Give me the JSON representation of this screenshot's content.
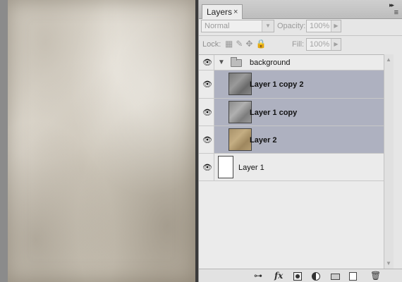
{
  "panel": {
    "tab_label": "Layers",
    "close_glyph": "×",
    "collapse_glyph": "▸▸",
    "menu_glyph": "≡"
  },
  "blend": {
    "mode": "Normal"
  },
  "opacity": {
    "label": "Opacity:",
    "value": "100%"
  },
  "lock": {
    "label": "Lock:"
  },
  "fill": {
    "label": "Fill:",
    "value": "100%"
  },
  "layers": [
    {
      "name": "background",
      "type": "group",
      "visible": true,
      "expanded": true,
      "selected": false
    },
    {
      "name": "Layer 1 copy 2",
      "type": "layer",
      "visible": true,
      "selected": true
    },
    {
      "name": "Layer 1 copy",
      "type": "layer",
      "visible": true,
      "selected": true
    },
    {
      "name": "Layer 2",
      "type": "layer",
      "visible": true,
      "selected": true
    },
    {
      "name": "Layer 1",
      "type": "layer",
      "visible": true,
      "selected": false
    }
  ],
  "glyphs": {
    "eye": "👁",
    "group_arrow": "▼",
    "scroll_up": "▲",
    "scroll_down": "▼",
    "link": "⊶",
    "fx": "fx",
    "trash": "🗑"
  },
  "colors": {
    "selected_row": "#aeb1c0",
    "panel_bg": "#e6e6e6"
  },
  "icons": [
    "link-layers-icon",
    "fx-icon",
    "layer-mask-icon",
    "adjustment-layer-icon",
    "new-group-icon",
    "new-layer-icon",
    "trash-icon"
  ]
}
